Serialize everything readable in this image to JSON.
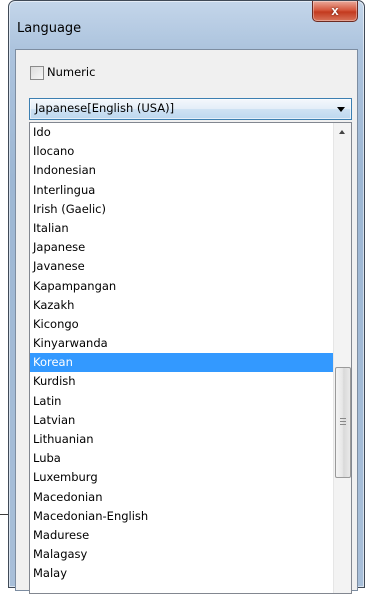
{
  "window": {
    "title": "Language",
    "close_glyph": "x"
  },
  "options": {
    "numeric_label": "Numeric",
    "numeric_checked": false
  },
  "combo": {
    "selected_value": "Japanese[English (USA)]"
  },
  "language_list": {
    "items": [
      "Ido",
      "Ilocano",
      "Indonesian",
      "Interlingua",
      "Irish (Gaelic)",
      "Italian",
      "Japanese",
      "Javanese",
      "Kapampangan",
      "Kazakh",
      "Kicongo",
      "Kinyarwanda",
      "Korean",
      "Kurdish",
      "Latin",
      "Latvian",
      "Lithuanian",
      "Luba",
      "Luxemburg",
      "Macedonian",
      "Macedonian-English",
      "Madurese",
      "Malagasy",
      "Malay"
    ],
    "selected_item": "Korean"
  },
  "colors": {
    "selection": "#3399ff",
    "close_button": "#c33a1f"
  },
  "icons": {
    "close": "close-icon",
    "dropdown": "chevron-down-icon",
    "scroll_up": "chevron-up-icon",
    "grip": "grip-icon"
  }
}
